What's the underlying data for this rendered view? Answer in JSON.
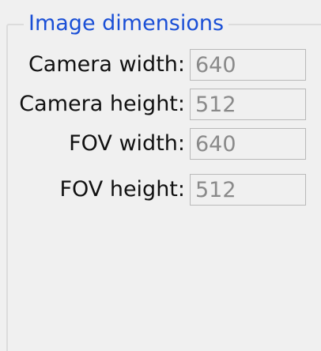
{
  "group": {
    "title": "Image dimensions"
  },
  "fields": [
    {
      "label": "Camera width:",
      "value": "640"
    },
    {
      "label": "Camera height:",
      "value": "512"
    },
    {
      "label": "FOV width:",
      "value": "640"
    },
    {
      "label": "FOV height:",
      "value": "512"
    }
  ]
}
